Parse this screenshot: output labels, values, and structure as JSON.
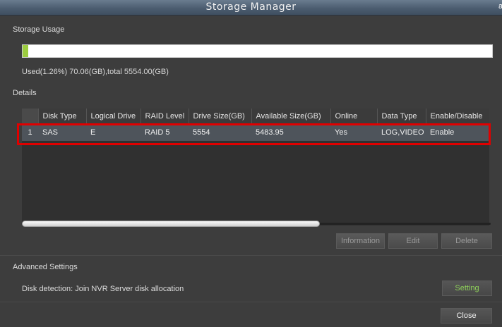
{
  "window": {
    "title": "Storage Manager",
    "corner_glyph": "a"
  },
  "storage_usage": {
    "label": "Storage Usage",
    "used_fraction": 0.0126,
    "summary": "Used(1.26%) 70.06(GB),total 5554.00(GB)"
  },
  "details": {
    "label": "Details",
    "columns": [
      "",
      "Disk Type",
      "Logical Drive",
      "RAID Level",
      "Drive Size(GB)",
      "Available Size(GB)",
      "Online",
      "Data Type",
      "Enable/Disable"
    ],
    "rows": [
      [
        "1",
        "SAS",
        "E",
        "RAID 5",
        "5554",
        "5483.95",
        "Yes",
        "LOG,VIDEO",
        "Enable"
      ]
    ]
  },
  "actions": {
    "information": "Information",
    "edit": "Edit",
    "delete": "Delete"
  },
  "advanced": {
    "label": "Advanced Settings",
    "detection_text": "Disk detection: Join NVR Server disk allocation",
    "setting_button": "Setting"
  },
  "footer": {
    "close_button": "Close"
  },
  "colors": {
    "usage_fill": "#9ccc3f",
    "highlight": "#e00000",
    "setting_text": "#8ed05a"
  }
}
